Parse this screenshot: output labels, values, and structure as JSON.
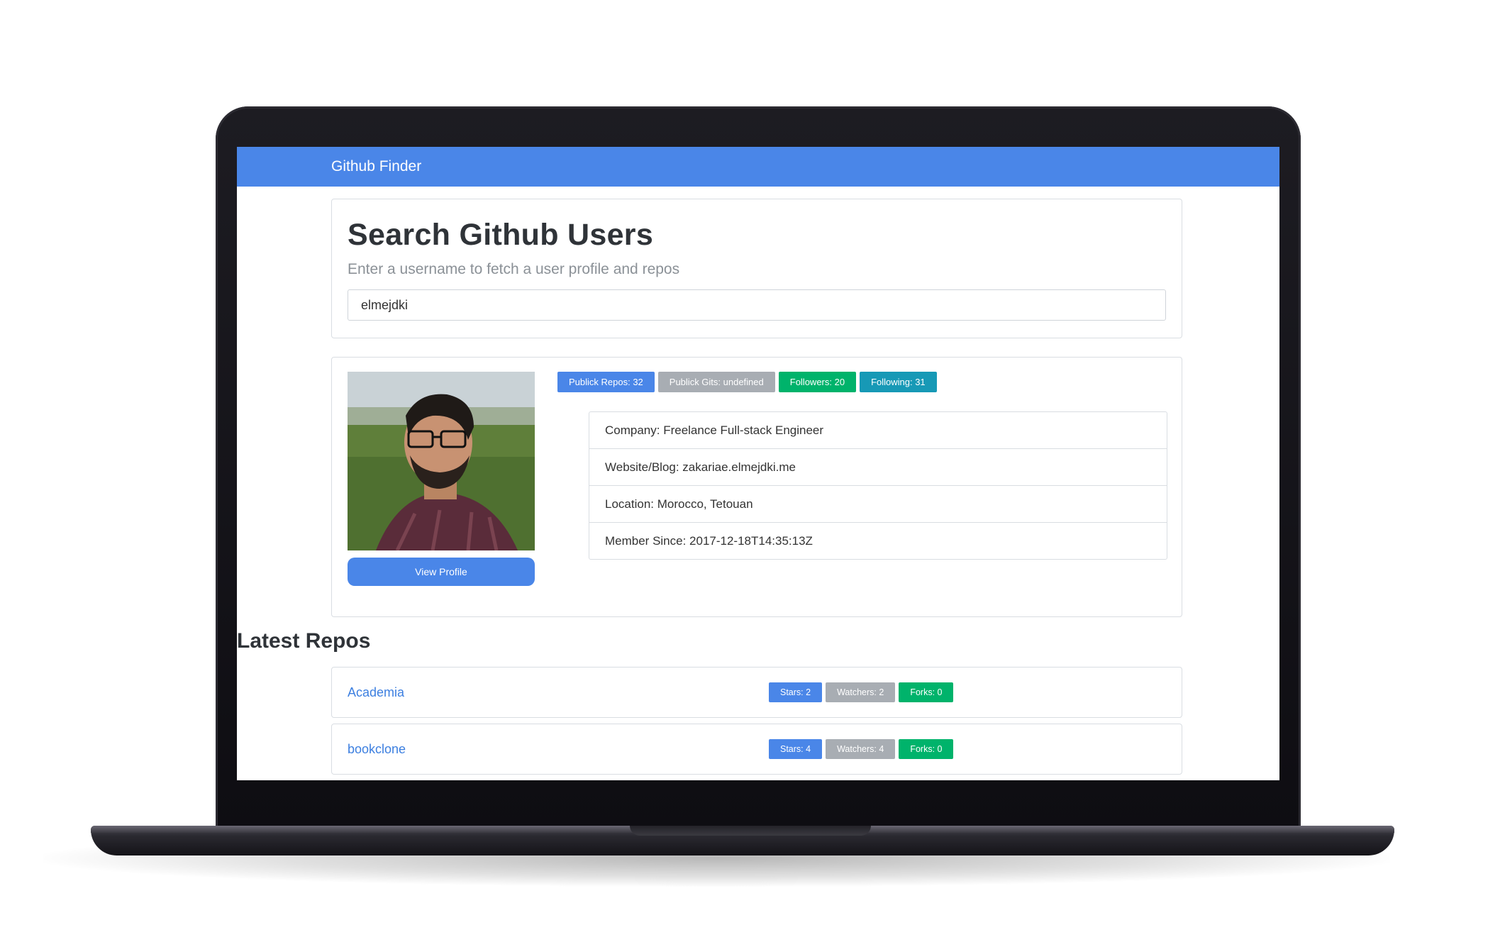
{
  "navbar": {
    "brand": "Github Finder"
  },
  "search": {
    "title": "Search Github Users",
    "subtitle": "Enter a username to fetch a user profile and repos",
    "value": "elmejdki"
  },
  "profile": {
    "view_button": "View Profile",
    "badges": {
      "public_repos": "Publick Repos: 32",
      "public_gists": "Publick Gits: undefined",
      "followers": "Followers: 20",
      "following": "Following: 31"
    },
    "info": {
      "company": "Company: Freelance Full-stack Engineer",
      "website": "Website/Blog: zakariae.elmejdki.me",
      "location": "Location: Morocco, Tetouan",
      "member_since": "Member Since: 2017-12-18T14:35:13Z"
    }
  },
  "repos": {
    "heading": "Latest Repos",
    "items": [
      {
        "name": "Academia",
        "stars": "Stars: 2",
        "watchers": "Watchers: 2",
        "forks": "Forks: 0"
      },
      {
        "name": "bookclone",
        "stars": "Stars: 4",
        "watchers": "Watchers: 4",
        "forks": "Forks: 0"
      }
    ]
  },
  "colors": {
    "primary": "#4a86e8",
    "secondary": "#a8adb3",
    "success": "#00b36b",
    "info": "#1799b6",
    "link": "#3c7fe0"
  }
}
